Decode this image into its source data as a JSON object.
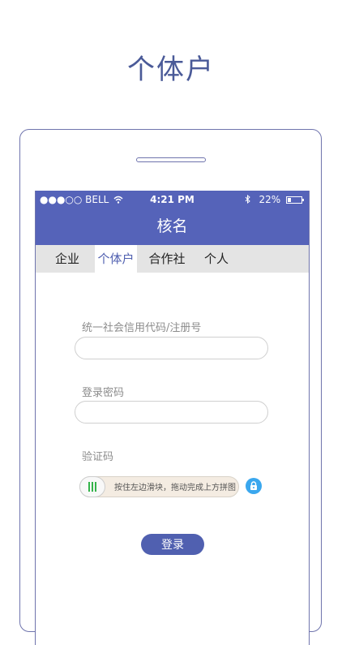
{
  "headline": "个体户",
  "status_bar": {
    "carrier": "●●●○○ BELL",
    "time": "4:21 PM",
    "battery": "22%"
  },
  "nav": {
    "title": "核名"
  },
  "tabs": [
    {
      "label": "企业",
      "active": false
    },
    {
      "label": "个体户",
      "active": true
    },
    {
      "label": "合作社",
      "active": false
    },
    {
      "label": "个人",
      "active": false
    }
  ],
  "form": {
    "credit_code_label": "统一社会信用代码/注册号",
    "credit_code_value": "",
    "password_label": "登录密码",
    "password_value": "",
    "captcha_label": "验证码",
    "slider_hint": "按住左边滑块，拖动完成上方拼图",
    "submit_label": "登录"
  },
  "colors": {
    "brand": "#5563b9",
    "tab_active_text": "#5060b0",
    "lock_icon": "#3aa7ee",
    "slider_grip": "#34b34a"
  }
}
